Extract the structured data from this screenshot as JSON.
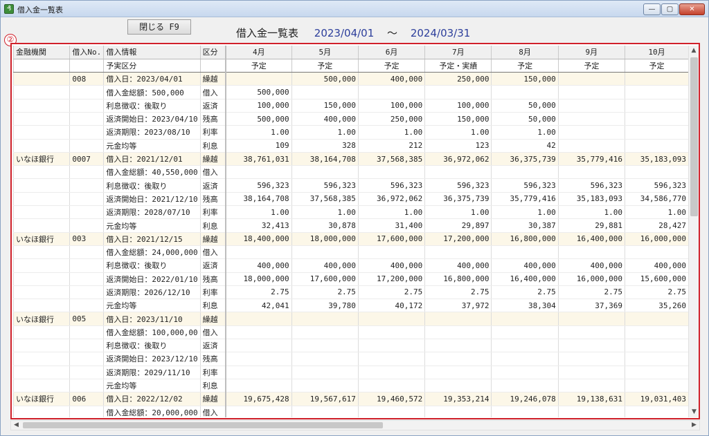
{
  "window": {
    "title": "借入金一覧表",
    "min_glyph": "—",
    "max_glyph": "▢",
    "close_glyph": "✕"
  },
  "toolbar": {
    "close_label": "閉じる F9"
  },
  "report": {
    "title": "借入金一覧表",
    "start": "2023/04/01",
    "tilde": "～",
    "end": "2024/03/31"
  },
  "marker": "②",
  "columns": {
    "bank": "金融機関",
    "no": "借入No.",
    "info": "借入情報",
    "kubun": "区分",
    "months": [
      "4月",
      "5月",
      "6月",
      "7月",
      "8月",
      "9月",
      "10月"
    ],
    "plan_label": "予実区分",
    "plan": [
      "予定",
      "予定",
      "予定",
      "予定・実績",
      "予定",
      "予定",
      "予定"
    ]
  },
  "loans": [
    {
      "bank": "",
      "no": "008",
      "rows": [
        {
          "info": "借入日：2023/04/01",
          "kubun": "繰越",
          "vals": [
            "",
            "500,000",
            "400,000",
            "250,000",
            "150,000",
            "",
            ""
          ]
        },
        {
          "info": "借入金総額：500,000",
          "kubun": "借入",
          "vals": [
            "500,000",
            "",
            "",
            "",
            "",
            "",
            ""
          ]
        },
        {
          "info": "利息徴収：後取り",
          "kubun": "返済",
          "vals": [
            "100,000",
            "150,000",
            "100,000",
            "100,000",
            "50,000",
            "",
            ""
          ]
        },
        {
          "info": "返済開始日：2023/04/10",
          "kubun": "残高",
          "vals": [
            "500,000",
            "400,000",
            "250,000",
            "150,000",
            "50,000",
            "",
            ""
          ]
        },
        {
          "info": "返済期限：2023/08/10",
          "kubun": "利率",
          "vals": [
            "1.00",
            "1.00",
            "1.00",
            "1.00",
            "1.00",
            "",
            ""
          ]
        },
        {
          "info": "元金均等",
          "kubun": "利息",
          "vals": [
            "109",
            "328",
            "212",
            "123",
            "42",
            "",
            ""
          ]
        }
      ]
    },
    {
      "bank": "いなほ銀行",
      "no": "0007",
      "rows": [
        {
          "info": "借入日：2021/12/01",
          "kubun": "繰越",
          "vals": [
            "38,761,031",
            "38,164,708",
            "37,568,385",
            "36,972,062",
            "36,375,739",
            "35,779,416",
            "35,183,093"
          ]
        },
        {
          "info": "借入金総額：40,550,000",
          "kubun": "借入",
          "vals": [
            "",
            "",
            "",
            "",
            "",
            "",
            ""
          ]
        },
        {
          "info": "利息徴収：後取り",
          "kubun": "返済",
          "vals": [
            "596,323",
            "596,323",
            "596,323",
            "596,323",
            "596,323",
            "596,323",
            "596,323"
          ]
        },
        {
          "info": "返済開始日：2021/12/10",
          "kubun": "残高",
          "vals": [
            "38,164,708",
            "37,568,385",
            "36,972,062",
            "36,375,739",
            "35,779,416",
            "35,183,093",
            "34,586,770"
          ]
        },
        {
          "info": "返済期限：2028/07/10",
          "kubun": "利率",
          "vals": [
            "1.00",
            "1.00",
            "1.00",
            "1.00",
            "1.00",
            "1.00",
            "1.00"
          ]
        },
        {
          "info": "元金均等",
          "kubun": "利息",
          "vals": [
            "32,413",
            "30,878",
            "31,400",
            "29,897",
            "30,387",
            "29,881",
            "28,427"
          ]
        }
      ]
    },
    {
      "bank": "いなほ銀行",
      "no": "003",
      "rows": [
        {
          "info": "借入日：2021/12/15",
          "kubun": "繰越",
          "vals": [
            "18,400,000",
            "18,000,000",
            "17,600,000",
            "17,200,000",
            "16,800,000",
            "16,400,000",
            "16,000,000"
          ]
        },
        {
          "info": "借入金総額：24,000,000",
          "kubun": "借入",
          "vals": [
            "",
            "",
            "",
            "",
            "",
            "",
            ""
          ]
        },
        {
          "info": "利息徴収：後取り",
          "kubun": "返済",
          "vals": [
            "400,000",
            "400,000",
            "400,000",
            "400,000",
            "400,000",
            "400,000",
            "400,000"
          ]
        },
        {
          "info": "返済開始日：2022/01/10",
          "kubun": "残高",
          "vals": [
            "18,000,000",
            "17,600,000",
            "17,200,000",
            "16,800,000",
            "16,400,000",
            "16,000,000",
            "15,600,000"
          ]
        },
        {
          "info": "返済期限：2026/12/10",
          "kubun": "利率",
          "vals": [
            "2.75",
            "2.75",
            "2.75",
            "2.75",
            "2.75",
            "2.75",
            "2.75"
          ]
        },
        {
          "info": "元金均等",
          "kubun": "利息",
          "vals": [
            "42,041",
            "39,780",
            "40,172",
            "37,972",
            "38,304",
            "37,369",
            "35,260"
          ]
        }
      ]
    },
    {
      "bank": "いなほ銀行",
      "no": "005",
      "rows": [
        {
          "info": "借入日：2023/11/10",
          "kubun": "繰越",
          "vals": [
            "",
            "",
            "",
            "",
            "",
            "",
            ""
          ]
        },
        {
          "info": "借入金総額：100,000,00",
          "kubun": "借入",
          "vals": [
            "",
            "",
            "",
            "",
            "",
            "",
            ""
          ]
        },
        {
          "info": "利息徴収：後取り",
          "kubun": "返済",
          "vals": [
            "",
            "",
            "",
            "",
            "",
            "",
            ""
          ]
        },
        {
          "info": "返済開始日：2023/12/10",
          "kubun": "残高",
          "vals": [
            "",
            "",
            "",
            "",
            "",
            "",
            ""
          ]
        },
        {
          "info": "返済期限：2029/11/10",
          "kubun": "利率",
          "vals": [
            "",
            "",
            "",
            "",
            "",
            "",
            ""
          ]
        },
        {
          "info": "元金均等",
          "kubun": "利息",
          "vals": [
            "",
            "",
            "",
            "",
            "",
            "",
            ""
          ]
        }
      ]
    },
    {
      "bank": "いなほ銀行",
      "no": "006",
      "rows": [
        {
          "info": "借入日：2022/12/02",
          "kubun": "繰越",
          "vals": [
            "19,675,428",
            "19,567,617",
            "19,460,572",
            "19,353,214",
            "19,246,078",
            "19,138,631",
            "19,031,403"
          ]
        },
        {
          "info": "借入金総額：20,000,000",
          "kubun": "借入",
          "vals": [
            "",
            "",
            "",
            "",
            "",
            "",
            ""
          ]
        }
      ]
    }
  ],
  "scroll": {
    "up": "▲",
    "down": "▼",
    "left": "◀",
    "right": "▶"
  }
}
